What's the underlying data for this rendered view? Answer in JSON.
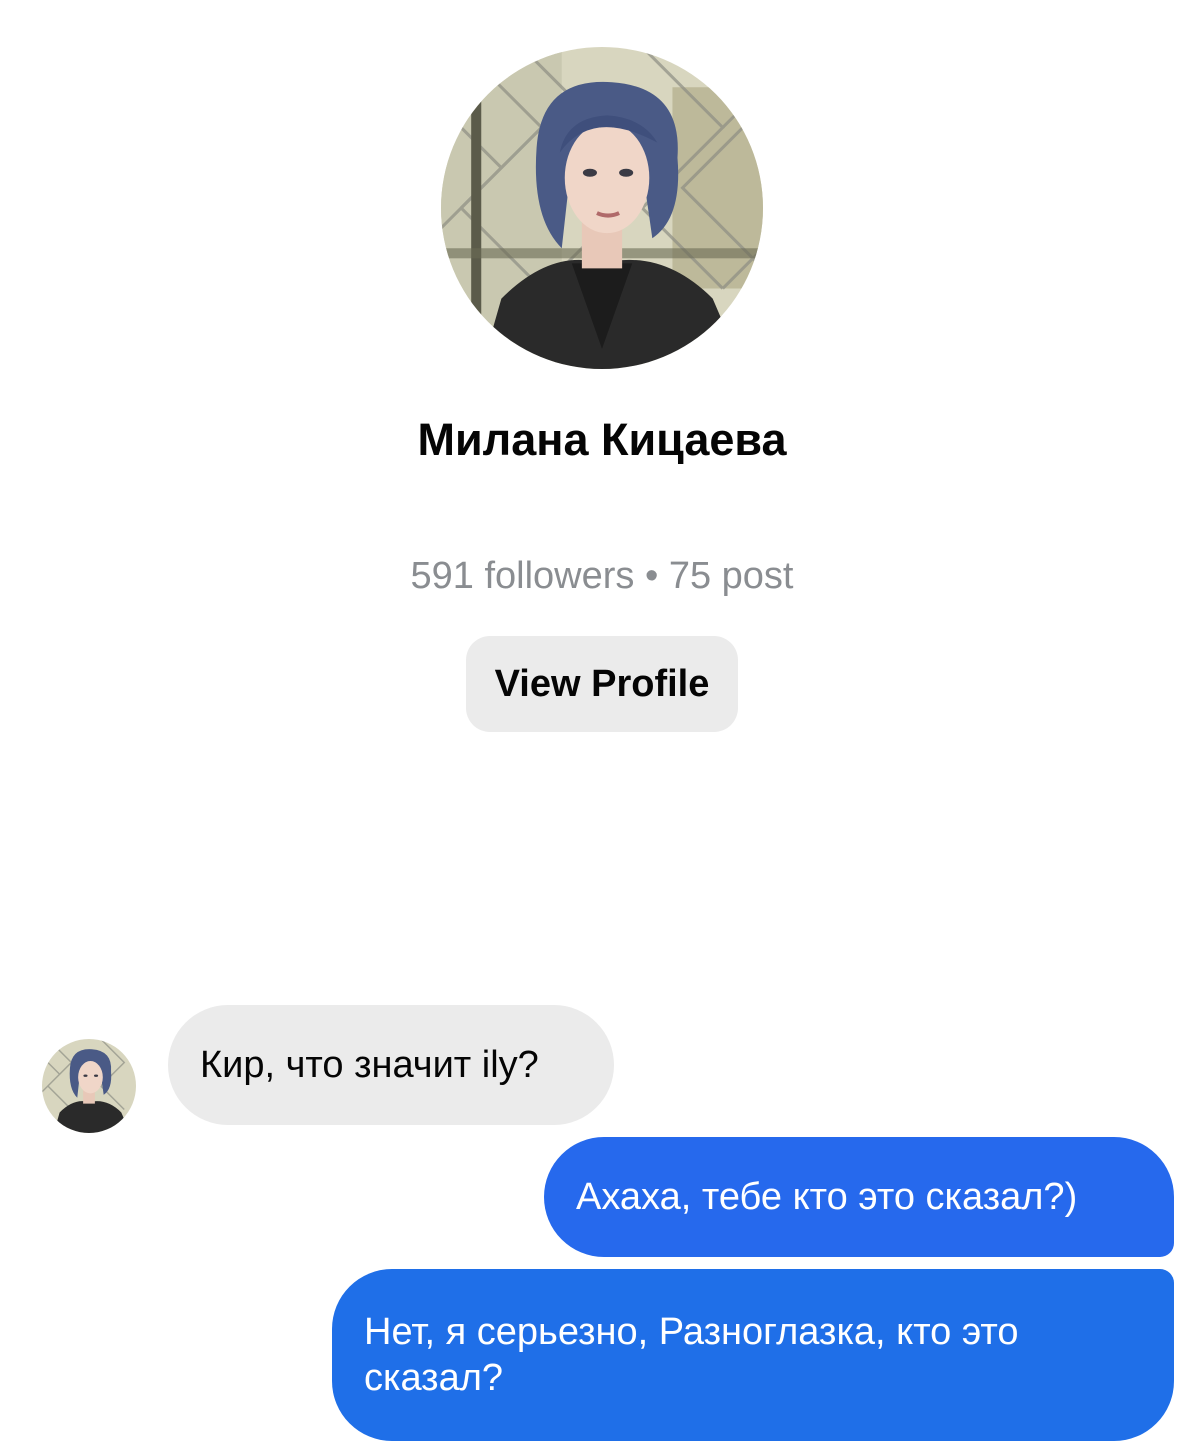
{
  "profile": {
    "avatar_icon": "profile-avatar-illustration",
    "name": "Милана Кицаева",
    "stats": "591 followers • 75 post",
    "view_profile_label": "View Profile"
  },
  "messages": [
    {
      "direction": "incoming",
      "text": "Кир, что значит ily?"
    },
    {
      "direction": "outgoing",
      "text": "Ахаха, тебе кто это сказал?)"
    },
    {
      "direction": "outgoing",
      "text": "Нет, я серьезно, Разноглазка, кто это сказал?"
    }
  ],
  "colors": {
    "incoming_bubble": "#ebebeb",
    "outgoing_bubble": "#2669ed",
    "stats_text": "#8a8d91"
  }
}
